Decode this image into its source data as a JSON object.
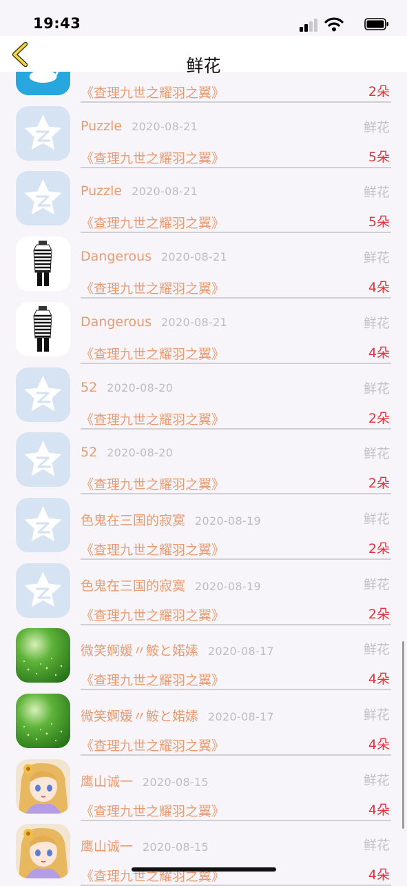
{
  "status": {
    "time": "19:43"
  },
  "nav": {
    "title": "鲜花",
    "back_icon": "chevron-left-icon"
  },
  "colors": {
    "accent": "#eb9a6f",
    "count": "#e2323a",
    "muted": "#c2c2c2",
    "nav_chevron": "#f2d64a"
  },
  "list": {
    "items": [
      {
        "sender": "",
        "date": "",
        "type": "",
        "book": "《查理九世之耀羽之翼》",
        "count": "2朵",
        "avatar": "cup-avatar"
      },
      {
        "sender": "Puzzle",
        "date": "2020-08-21",
        "type": "鲜花",
        "book": "《查理九世之耀羽之翼》",
        "count": "5朵",
        "avatar": "default-avatar"
      },
      {
        "sender": "Puzzle",
        "date": "2020-08-21",
        "type": "鲜花",
        "book": "《查理九世之耀羽之翼》",
        "count": "5朵",
        "avatar": "default-avatar"
      },
      {
        "sender": "Dangerous",
        "date": "2020-08-21",
        "type": "鲜花",
        "book": "《查理九世之耀羽之翼》",
        "count": "4朵",
        "avatar": "fashion-avatar"
      },
      {
        "sender": "Dangerous",
        "date": "2020-08-21",
        "type": "鲜花",
        "book": "《查理九世之耀羽之翼》",
        "count": "4朵",
        "avatar": "fashion-avatar"
      },
      {
        "sender": "52",
        "date": "2020-08-20",
        "type": "鲜花",
        "book": "《查理九世之耀羽之翼》",
        "count": "2朵",
        "avatar": "default-avatar"
      },
      {
        "sender": "52",
        "date": "2020-08-20",
        "type": "鲜花",
        "book": "《查理九世之耀羽之翼》",
        "count": "2朵",
        "avatar": "default-avatar"
      },
      {
        "sender": "色鬼在三国的寂寞",
        "date": "2020-08-19",
        "type": "鲜花",
        "book": "《查理九世之耀羽之翼》",
        "count": "2朵",
        "avatar": "default-avatar"
      },
      {
        "sender": "色鬼在三国的寂寞",
        "date": "2020-08-19",
        "type": "鲜花",
        "book": "《查理九世之耀羽之翼》",
        "count": "2朵",
        "avatar": "default-avatar"
      },
      {
        "sender": "微笑婀媛〃鮟と婼嫊",
        "date": "2020-08-17",
        "type": "鲜花",
        "book": "《查理九世之耀羽之翼》",
        "count": "4朵",
        "avatar": "green-avatar"
      },
      {
        "sender": "微笑婀媛〃鮟と婼嫊",
        "date": "2020-08-17",
        "type": "鲜花",
        "book": "《查理九世之耀羽之翼》",
        "count": "4朵",
        "avatar": "green-avatar"
      },
      {
        "sender": "鹰山诚一",
        "date": "2020-08-15",
        "type": "鲜花",
        "book": "《查理九世之耀羽之翼》",
        "count": "4朵",
        "avatar": "anime-avatar"
      },
      {
        "sender": "鹰山诚一",
        "date": "2020-08-15",
        "type": "鲜花",
        "book": "《查理九世之耀羽之翼》",
        "count": "4朵",
        "avatar": "anime-avatar"
      }
    ]
  }
}
